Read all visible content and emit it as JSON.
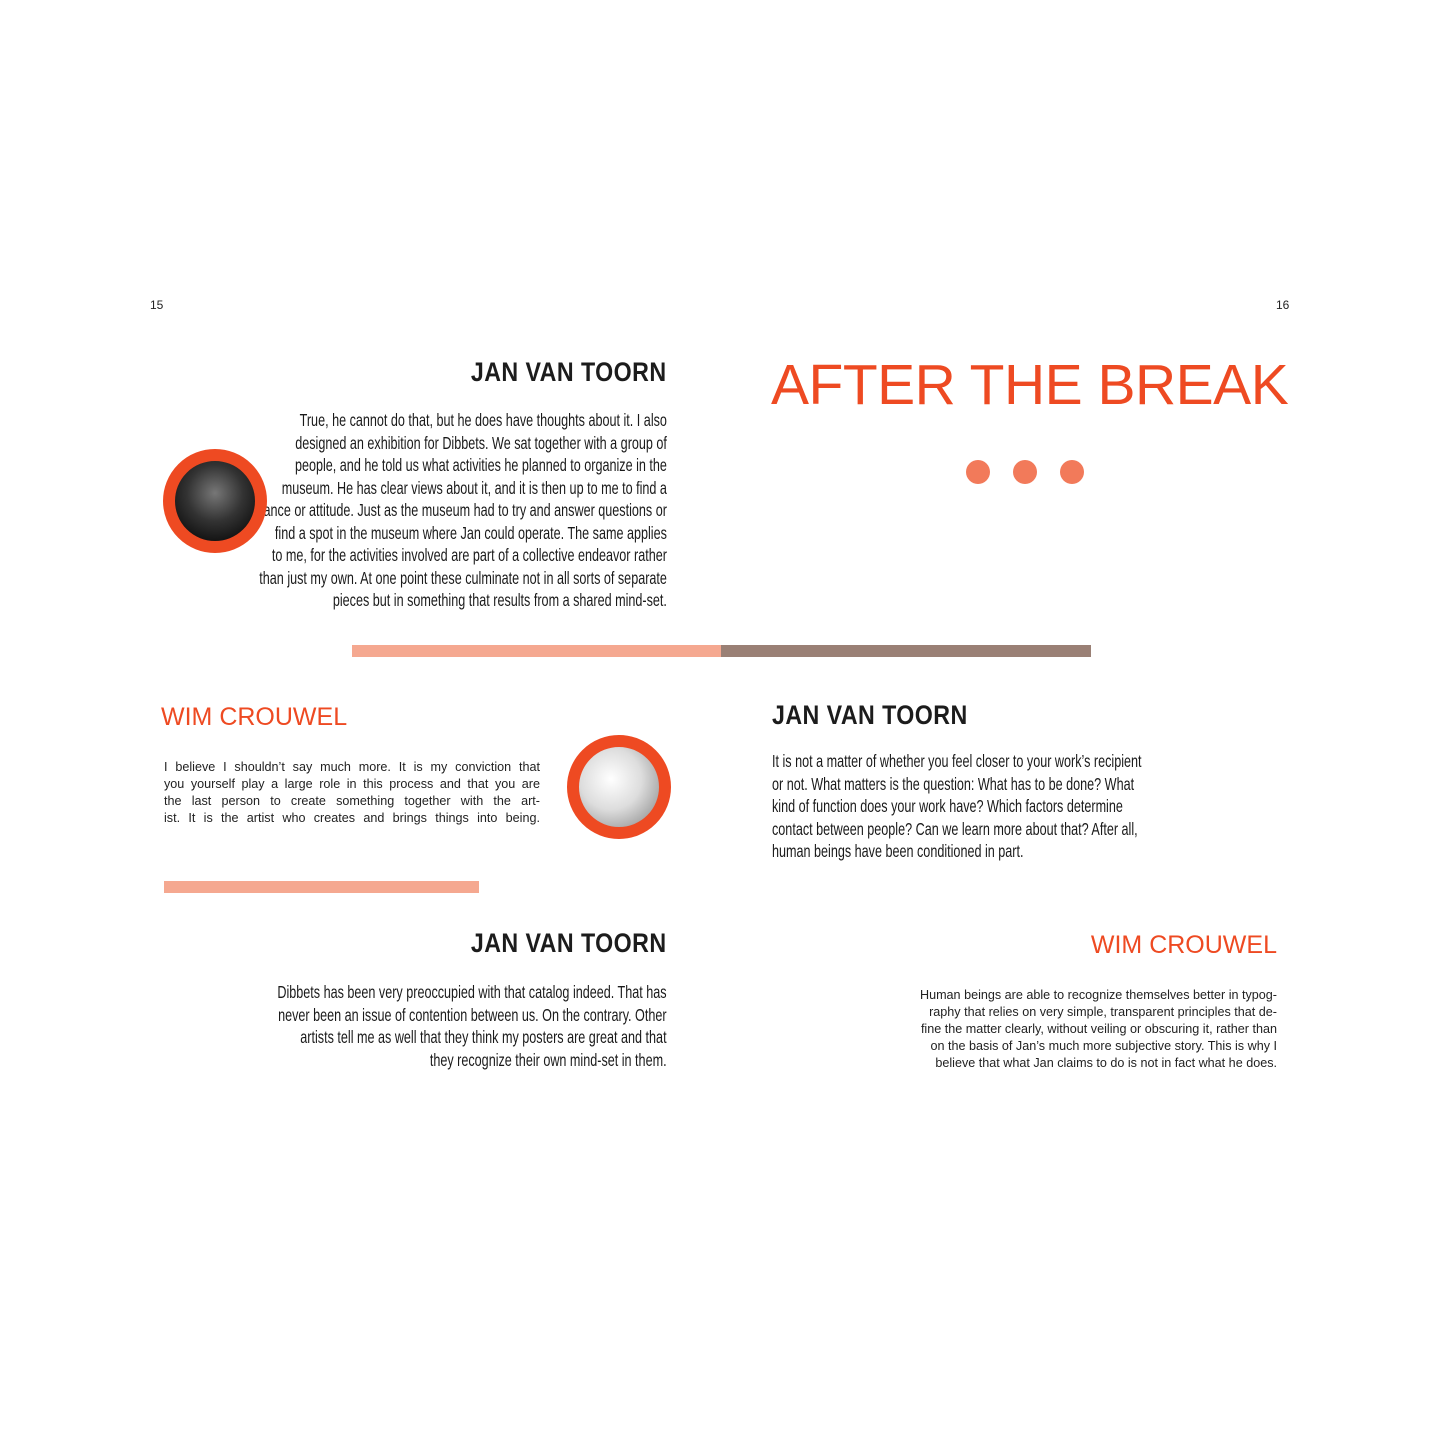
{
  "page_numbers": {
    "left": "15",
    "right": "16"
  },
  "colors": {
    "accent": "#ee4a22",
    "dot": "#f27a5a",
    "bar_light": "#f5a890",
    "bar_dark": "#9a8075"
  },
  "left_page": {
    "block1": {
      "heading": "JAN VAN TOORN",
      "lines": [
        "True, he cannot do that, but he does have thoughts about it. I also",
        "designed an exhibition for Dibbets. We sat together with a group of",
        "people, and he told us what activities he planned to organize in the",
        "museum. He has clear views about it, and it is then up to me to find a",
        "stance or attitude. Just as the museum had to try and answer questions or",
        "find a spot in the museum where Jan could operate. The same applies",
        "to me, for the activities involved are part of a collective endeavor rather",
        "than just my own. At one point these culminate not in all sorts of separate",
        "pieces but in something that results from a shared mind-set."
      ]
    },
    "block2": {
      "heading": "WIM CROUWEL",
      "lines": [
        "I believe I shouldn’t say much more. It is my conviction that",
        "you yourself play a large role in this process and that you are",
        "the last person to create something together with the art-",
        "ist. It is the artist who creates and brings things into being."
      ]
    },
    "block3": {
      "heading": "JAN VAN TOORN",
      "lines": [
        "Dibbets has been very preoccupied with that catalog indeed. That has",
        "never been an issue of contention between us. On the contrary. Other",
        "artists tell me as well that they think my posters are great and that",
        "they recognize their own mind-set in them."
      ]
    }
  },
  "right_page": {
    "title": "AFTER THE BREAK",
    "block1": {
      "heading": "JAN VAN TOORN",
      "lines": [
        "It is not a matter of whether you feel closer to your work’s recipient",
        "or not. What matters is the question: What has to be done? What",
        "kind of function does your work have? Which factors determine",
        "contact between people? Can we learn more about that? After all,",
        "human beings have been conditioned in part."
      ]
    },
    "block2": {
      "heading": "WIM CROUWEL",
      "lines": [
        "Human beings are able to recognize themselves better in typog-",
        "raphy that relies on very simple, transparent principles that de-",
        "fine the matter clearly, without veiling or obscuring it, rather than",
        "on the basis of Jan’s much more subjective story. This is why I",
        "believe that what Jan claims to do is not in fact what he does."
      ]
    }
  }
}
